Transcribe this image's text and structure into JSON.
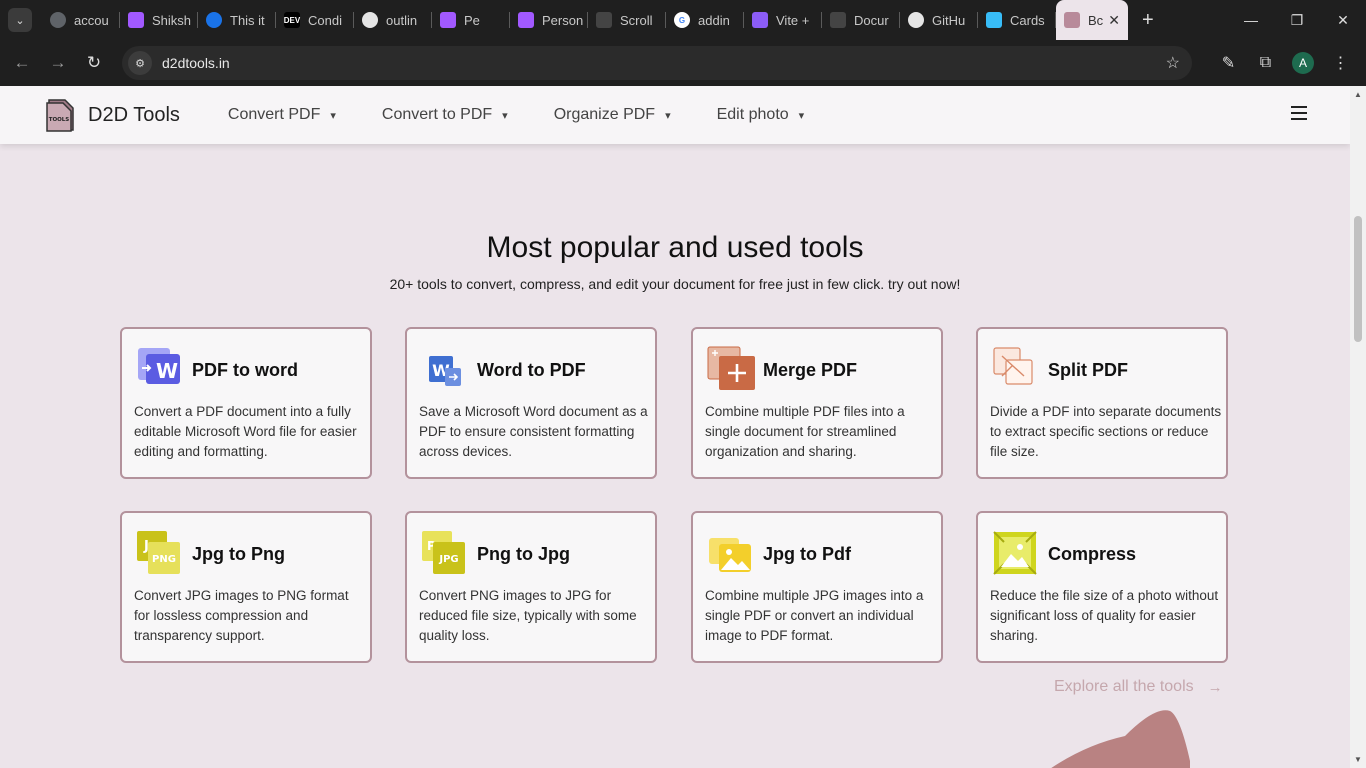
{
  "browser": {
    "tabs": [
      {
        "label": "accou",
        "color": "#5f6368",
        "glyph": ""
      },
      {
        "label": "Shiksh",
        "color": "#a259ff",
        "glyph": ""
      },
      {
        "label": "This it",
        "color": "#1a73e8",
        "glyph": ""
      },
      {
        "label": "Condi",
        "color": "#000000",
        "glyph": "DEV"
      },
      {
        "label": "outlin",
        "color": "#333333",
        "glyph": ""
      },
      {
        "label": "Pe",
        "color": "#a259ff",
        "glyph": ""
      },
      {
        "label": "Person",
        "color": "#a259ff",
        "glyph": ""
      },
      {
        "label": "Scroll",
        "color": "#222222",
        "glyph": ""
      },
      {
        "label": "addin",
        "color": "#4285f4",
        "glyph": "G"
      },
      {
        "label": "Vite +",
        "color": "#8b5cf6",
        "glyph": ""
      },
      {
        "label": "Docur",
        "color": "#222222",
        "glyph": ""
      },
      {
        "label": "GitHu",
        "color": "#333333",
        "glyph": ""
      },
      {
        "label": "Cards",
        "color": "#38bdf8",
        "glyph": ""
      }
    ],
    "active_tab": {
      "label": "Bc",
      "close": "✕"
    },
    "new_tab": "+",
    "window_controls": {
      "minimize": "—",
      "maximize": "❐",
      "close": "✕"
    },
    "nav": {
      "back": "←",
      "forward": "→",
      "reload": "↻"
    },
    "url": "d2dtools.in",
    "star": "☆",
    "avatar_letter": "A",
    "toolbar_icons": {
      "pen": "✎",
      "extensions": "⧉",
      "menu": "⋮"
    }
  },
  "site": {
    "brand": "D2D Tools",
    "logo_text": "TOOLS",
    "menu": [
      {
        "label": "Convert PDF"
      },
      {
        "label": "Convert to PDF"
      },
      {
        "label": "Organize PDF"
      },
      {
        "label": "Edit photo"
      }
    ],
    "chevron": "⌄"
  },
  "main": {
    "title": "Most popular and used tools",
    "subtitle": "20+ tools to convert, compress, and edit your document for free just in few click. try out now!",
    "cards": [
      {
        "title": "PDF to word",
        "desc": "Convert a PDF document into a fully editable Microsoft Word file for easier editing and formatting.",
        "icon": "pdf-to-word-icon"
      },
      {
        "title": "Word to PDF",
        "desc": "Save a Microsoft Word document as a PDF to ensure consistent formatting across devices.",
        "icon": "word-to-pdf-icon"
      },
      {
        "title": "Merge PDF",
        "desc": "Combine multiple PDF files into a single document for streamlined organization and sharing.",
        "icon": "merge-pdf-icon"
      },
      {
        "title": "Split PDF",
        "desc": "Divide a PDF into separate documents to extract specific sections or reduce file size.",
        "icon": "split-pdf-icon"
      },
      {
        "title": "Jpg to Png",
        "desc": "Convert JPG images to PNG format for lossless compression and transparency support.",
        "icon": "jpg-to-png-icon"
      },
      {
        "title": "Png to Jpg",
        "desc": "Convert PNG images to JPG for reduced file size, typically with some quality loss.",
        "icon": "png-to-jpg-icon"
      },
      {
        "title": "Jpg to Pdf",
        "desc": "Combine multiple JPG images into a single PDF or convert an individual image to PDF format.",
        "icon": "jpg-to-pdf-icon"
      },
      {
        "title": "Compress",
        "desc": "Reduce the file size of a photo without significant loss of quality for easier sharing.",
        "icon": "compress-icon"
      }
    ],
    "explore": "Explore all the tools",
    "explore_arrow": "→"
  },
  "icon_text": {
    "word_w": "W",
    "jpg_png_big": "J",
    "jpg_png_small": "PNG",
    "png_jpg_big": "P",
    "png_jpg_small": "JPG"
  },
  "colors": {
    "card_border": "#b3929c",
    "explore_link": "#c5a7ad",
    "page_bg": "#ece4ea"
  }
}
